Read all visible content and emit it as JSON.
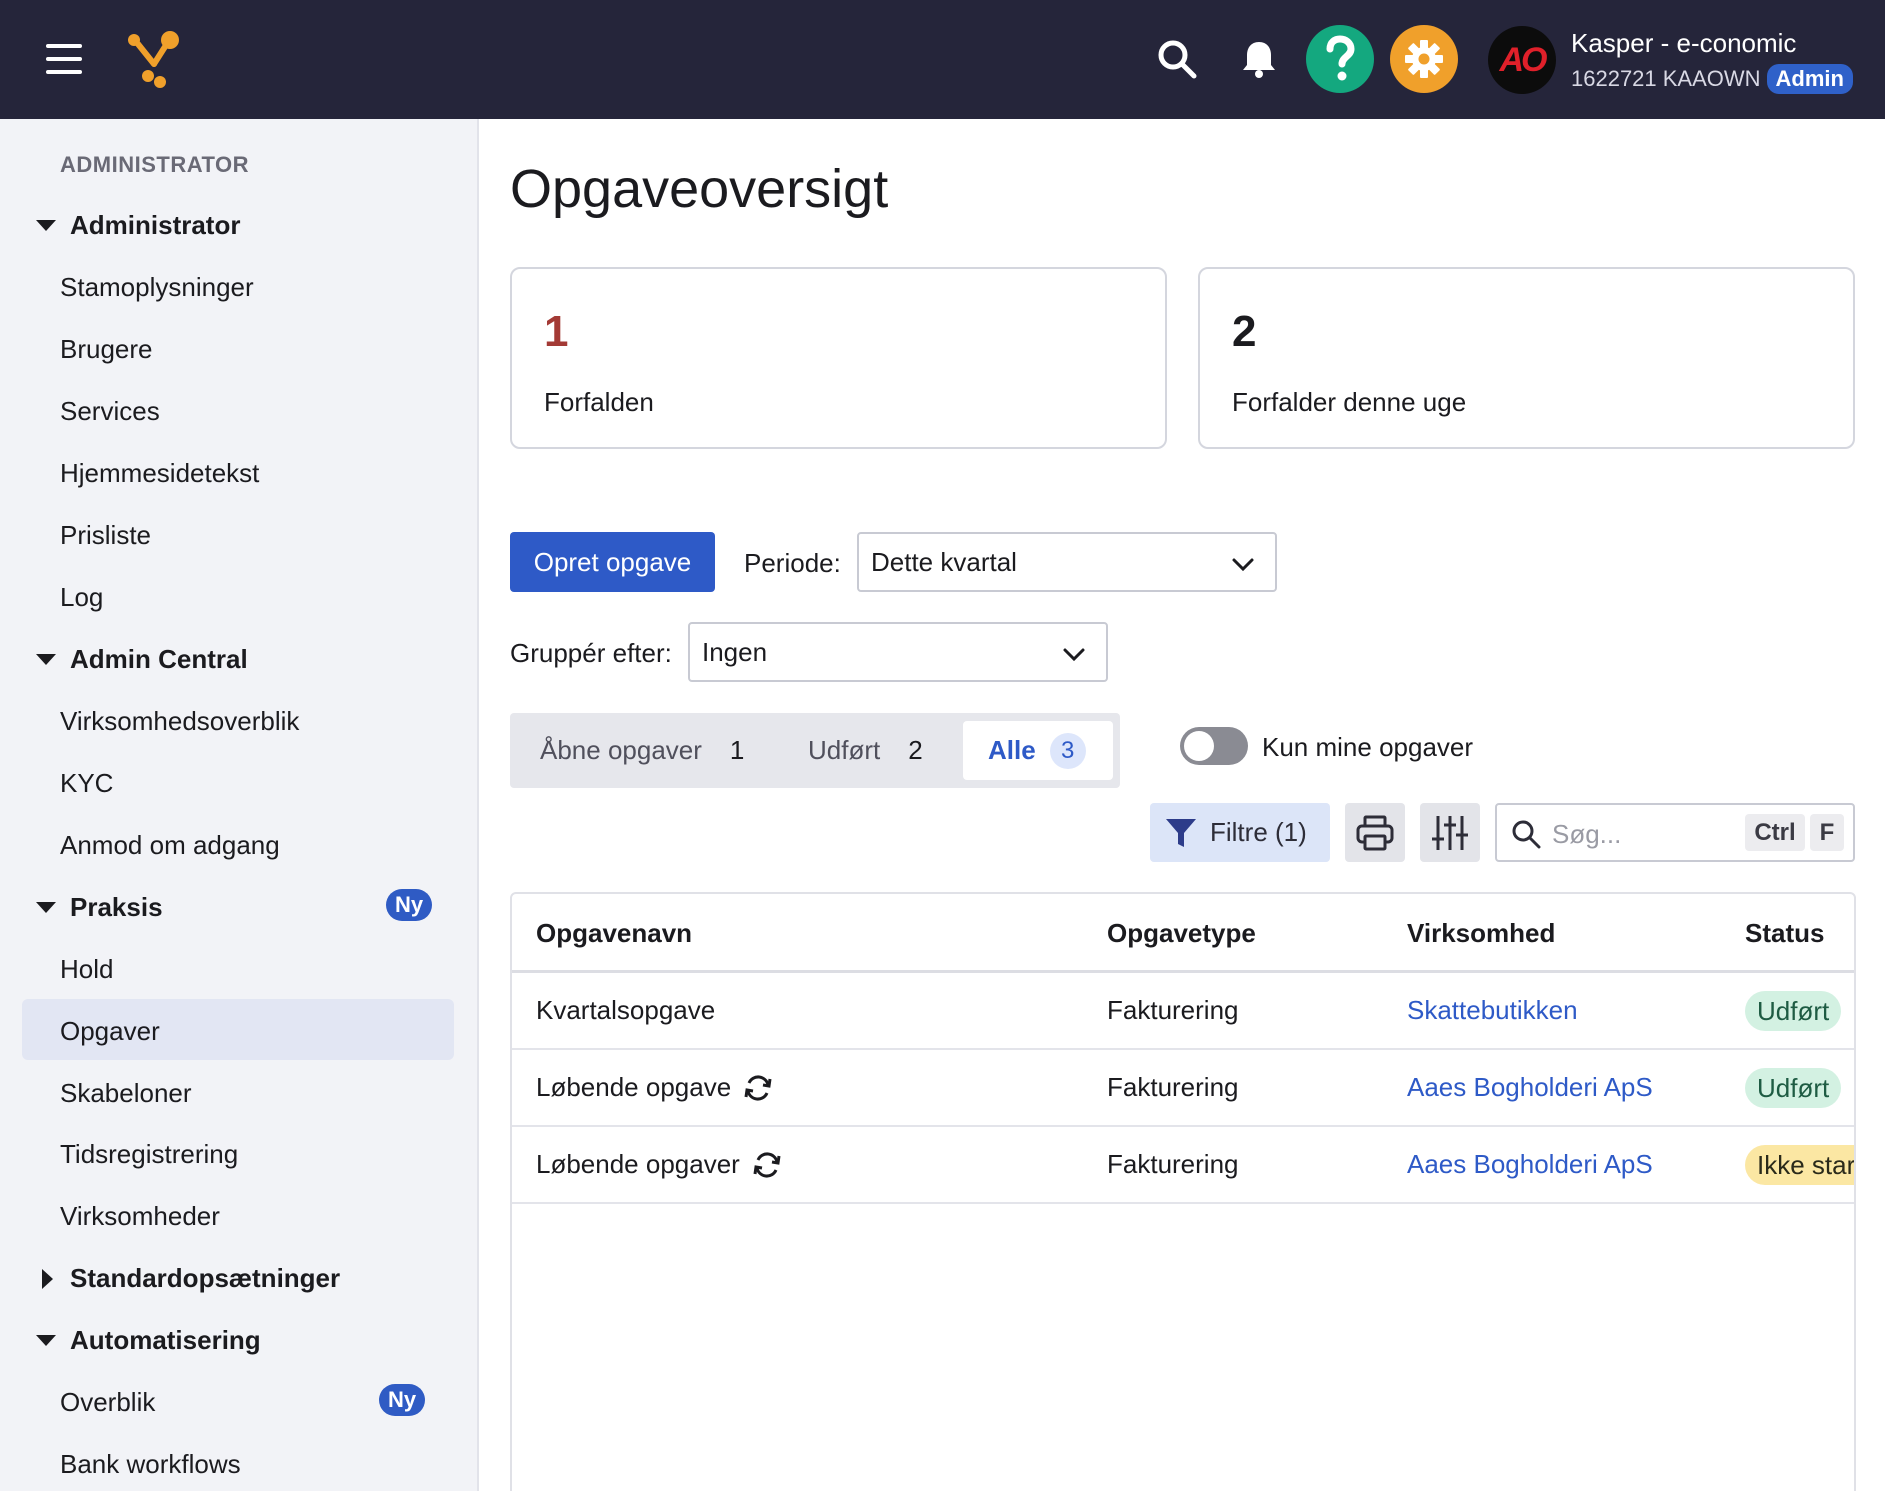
{
  "header": {
    "user_name": "Kasper - e-conomic",
    "account": "1622721 KAAOWN",
    "role_badge": "Admin",
    "avatar_text": "AO",
    "brand_colors": {
      "bar": "#25253a",
      "help": "#14a87f",
      "settings": "#f0a02b"
    }
  },
  "sidebar": {
    "section_title": "ADMINISTRATOR",
    "groups": [
      {
        "label": "Administrator",
        "expanded": true,
        "items": [
          "Stamoplysninger",
          "Brugere",
          "Services",
          "Hjemmesidetekst",
          "Prisliste",
          "Log"
        ]
      },
      {
        "label": "Admin Central",
        "expanded": true,
        "items": [
          "Virksomhedsoverblik",
          "KYC",
          "Anmod om adgang"
        ]
      },
      {
        "label": "Praksis",
        "expanded": true,
        "badge": "Ny",
        "items": [
          "Hold",
          "Opgaver",
          "Skabeloner",
          "Tidsregistrering",
          "Virksomheder"
        ],
        "active_item": "Opgaver"
      },
      {
        "label": "Standardopsætninger",
        "expanded": false
      },
      {
        "label": "Automatisering",
        "expanded": true,
        "items": [
          "Overblik",
          "Bank workflows"
        ],
        "item_badge": "Ny"
      }
    ]
  },
  "main": {
    "title": "Opgaveoversigt",
    "cards": [
      {
        "number": "1",
        "label": "Forfalden",
        "color": "#a33a35"
      },
      {
        "number": "2",
        "label": "Forfalder denne uge",
        "color": "#1b1b1f"
      }
    ],
    "create_button": "Opret opgave",
    "period_label": "Periode:",
    "period_value": "Dette kvartal",
    "group_label": "Gruppér efter:",
    "group_value": "Ingen",
    "tabs": [
      {
        "label": "Åbne opgaver",
        "count": "1"
      },
      {
        "label": "Udført",
        "count": "2"
      },
      {
        "label": "Alle",
        "count": "3",
        "active": true
      }
    ],
    "only_mine_label": "Kun mine opgaver",
    "only_mine_on": false,
    "filter_button": "Filtre (1)",
    "search_placeholder": "Søg...",
    "shortcut_keys": [
      "Ctrl",
      "F"
    ],
    "table": {
      "columns": [
        "Opgavenavn",
        "Opgavetype",
        "Virksomhed",
        "Status"
      ],
      "rows": [
        {
          "name": "Kvartalsopgave",
          "recurring": false,
          "type": "Fakturering",
          "company": "Skattebutikken",
          "status": "Udført"
        },
        {
          "name": "Løbende opgave",
          "recurring": true,
          "type": "Fakturering",
          "company": "Aaes Bogholderi ApS",
          "status": "Udført"
        },
        {
          "name": "Løbende opgaver",
          "recurring": true,
          "type": "Fakturering",
          "company": "Aaes Bogholderi ApS",
          "status": "Ikke star"
        }
      ]
    }
  }
}
